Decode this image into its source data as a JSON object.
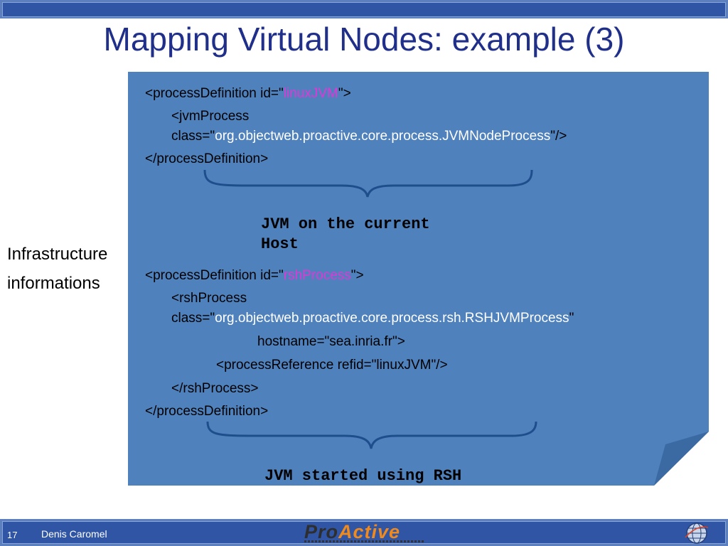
{
  "slide": {
    "title": "Mapping Virtual Nodes: example (3)",
    "left_label_line1": "Infrastructure",
    "left_label_line2": "informations"
  },
  "code": {
    "l1_pre": "<processDefinition id=\"",
    "l1_id": "linuxJVM",
    "l1_post": "\">",
    "l2": "<jvmProcess",
    "l3_pre": "class=\"",
    "l3_class": "org.objectweb.proactive.core.process.JVMNodeProcess",
    "l3_post": "\"/>",
    "l4": "</processDefinition>",
    "caption1_line1": "JVM on the current",
    "caption1_line2": "Host",
    "l5_pre": "<processDefinition id=\"",
    "l5_id": "rshProcess",
    "l5_post": "\">",
    "l6": "<rshProcess",
    "l7_pre": "class=\"",
    "l7_class": "org.objectweb.proactive.core.process.rsh.RSHJVMProcess",
    "l7_post": "\"",
    "l8": "hostname=\"sea.inria.fr\">",
    "l9": "<processReference refid=\"linuxJVM\"/>",
    "l10": "</rshProcess>",
    "l11": "</processDefinition>",
    "caption2": "JVM started using RSH"
  },
  "footer": {
    "page_number": "17",
    "author": "Denis Caromel",
    "logo_pro": "Pro",
    "logo_active": "Active",
    "logo_icon": "globe-icon"
  },
  "colors": {
    "note_bg": "#4f81bd",
    "title": "#1f2f8a",
    "id_highlight": "#e236d6",
    "class_highlight": "#ffffff",
    "bar": "#2f55a4"
  }
}
